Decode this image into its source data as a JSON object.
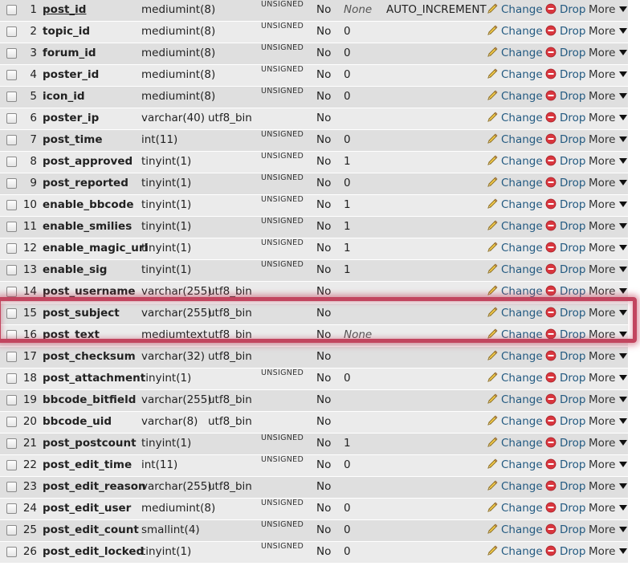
{
  "actions": {
    "change_label": "Change",
    "drop_label": "Drop",
    "more_label": "More"
  },
  "colors": {
    "row_odd": "#dfdfdf",
    "row_even": "#ebebeb",
    "action_link": "#235a81",
    "highlight": "#c2455f"
  },
  "icons": {
    "change": "pencil-icon",
    "drop": "drop-circle-icon",
    "more": "triangle-down-icon"
  },
  "rows": [
    {
      "num": "1",
      "name": "post_id",
      "type": "mediumint(8)",
      "collation": "",
      "attributes": "UNSIGNED",
      "null": "No",
      "default": "None",
      "extra": "AUTO_INCREMENT",
      "primary": true
    },
    {
      "num": "2",
      "name": "topic_id",
      "type": "mediumint(8)",
      "collation": "",
      "attributes": "UNSIGNED",
      "null": "No",
      "default": "0",
      "extra": ""
    },
    {
      "num": "3",
      "name": "forum_id",
      "type": "mediumint(8)",
      "collation": "",
      "attributes": "UNSIGNED",
      "null": "No",
      "default": "0",
      "extra": ""
    },
    {
      "num": "4",
      "name": "poster_id",
      "type": "mediumint(8)",
      "collation": "",
      "attributes": "UNSIGNED",
      "null": "No",
      "default": "0",
      "extra": ""
    },
    {
      "num": "5",
      "name": "icon_id",
      "type": "mediumint(8)",
      "collation": "",
      "attributes": "UNSIGNED",
      "null": "No",
      "default": "0",
      "extra": ""
    },
    {
      "num": "6",
      "name": "poster_ip",
      "type": "varchar(40)",
      "collation": "utf8_bin",
      "attributes": "",
      "null": "No",
      "default": "",
      "extra": ""
    },
    {
      "num": "7",
      "name": "post_time",
      "type": "int(11)",
      "collation": "",
      "attributes": "UNSIGNED",
      "null": "No",
      "default": "0",
      "extra": ""
    },
    {
      "num": "8",
      "name": "post_approved",
      "type": "tinyint(1)",
      "collation": "",
      "attributes": "UNSIGNED",
      "null": "No",
      "default": "1",
      "extra": ""
    },
    {
      "num": "9",
      "name": "post_reported",
      "type": "tinyint(1)",
      "collation": "",
      "attributes": "UNSIGNED",
      "null": "No",
      "default": "0",
      "extra": ""
    },
    {
      "num": "10",
      "name": "enable_bbcode",
      "type": "tinyint(1)",
      "collation": "",
      "attributes": "UNSIGNED",
      "null": "No",
      "default": "1",
      "extra": ""
    },
    {
      "num": "11",
      "name": "enable_smilies",
      "type": "tinyint(1)",
      "collation": "",
      "attributes": "UNSIGNED",
      "null": "No",
      "default": "1",
      "extra": ""
    },
    {
      "num": "12",
      "name": "enable_magic_url",
      "type": "tinyint(1)",
      "collation": "",
      "attributes": "UNSIGNED",
      "null": "No",
      "default": "1",
      "extra": ""
    },
    {
      "num": "13",
      "name": "enable_sig",
      "type": "tinyint(1)",
      "collation": "",
      "attributes": "UNSIGNED",
      "null": "No",
      "default": "1",
      "extra": ""
    },
    {
      "num": "14",
      "name": "post_username",
      "type": "varchar(255)",
      "collation": "utf8_bin",
      "attributes": "",
      "null": "No",
      "default": "",
      "extra": ""
    },
    {
      "num": "15",
      "name": "post_subject",
      "type": "varchar(255)",
      "collation": "utf8_bin",
      "attributes": "",
      "null": "No",
      "default": "",
      "extra": ""
    },
    {
      "num": "16",
      "name": "post_text",
      "type": "mediumtext",
      "collation": "utf8_bin",
      "attributes": "",
      "null": "No",
      "default": "None",
      "extra": ""
    },
    {
      "num": "17",
      "name": "post_checksum",
      "type": "varchar(32)",
      "collation": "utf8_bin",
      "attributes": "",
      "null": "No",
      "default": "",
      "extra": ""
    },
    {
      "num": "18",
      "name": "post_attachment",
      "type": "tinyint(1)",
      "collation": "",
      "attributes": "UNSIGNED",
      "null": "No",
      "default": "0",
      "extra": ""
    },
    {
      "num": "19",
      "name": "bbcode_bitfield",
      "type": "varchar(255)",
      "collation": "utf8_bin",
      "attributes": "",
      "null": "No",
      "default": "",
      "extra": ""
    },
    {
      "num": "20",
      "name": "bbcode_uid",
      "type": "varchar(8)",
      "collation": "utf8_bin",
      "attributes": "",
      "null": "No",
      "default": "",
      "extra": ""
    },
    {
      "num": "21",
      "name": "post_postcount",
      "type": "tinyint(1)",
      "collation": "",
      "attributes": "UNSIGNED",
      "null": "No",
      "default": "1",
      "extra": ""
    },
    {
      "num": "22",
      "name": "post_edit_time",
      "type": "int(11)",
      "collation": "",
      "attributes": "UNSIGNED",
      "null": "No",
      "default": "0",
      "extra": ""
    },
    {
      "num": "23",
      "name": "post_edit_reason",
      "type": "varchar(255)",
      "collation": "utf8_bin",
      "attributes": "",
      "null": "No",
      "default": "",
      "extra": ""
    },
    {
      "num": "24",
      "name": "post_edit_user",
      "type": "mediumint(8)",
      "collation": "",
      "attributes": "UNSIGNED",
      "null": "No",
      "default": "0",
      "extra": ""
    },
    {
      "num": "25",
      "name": "post_edit_count",
      "type": "smallint(4)",
      "collation": "",
      "attributes": "UNSIGNED",
      "null": "No",
      "default": "0",
      "extra": ""
    },
    {
      "num": "26",
      "name": "post_edit_locked",
      "type": "tinyint(1)",
      "collation": "",
      "attributes": "UNSIGNED",
      "null": "No",
      "default": "0",
      "extra": ""
    }
  ],
  "highlighted_rows": [
    "15",
    "16"
  ]
}
